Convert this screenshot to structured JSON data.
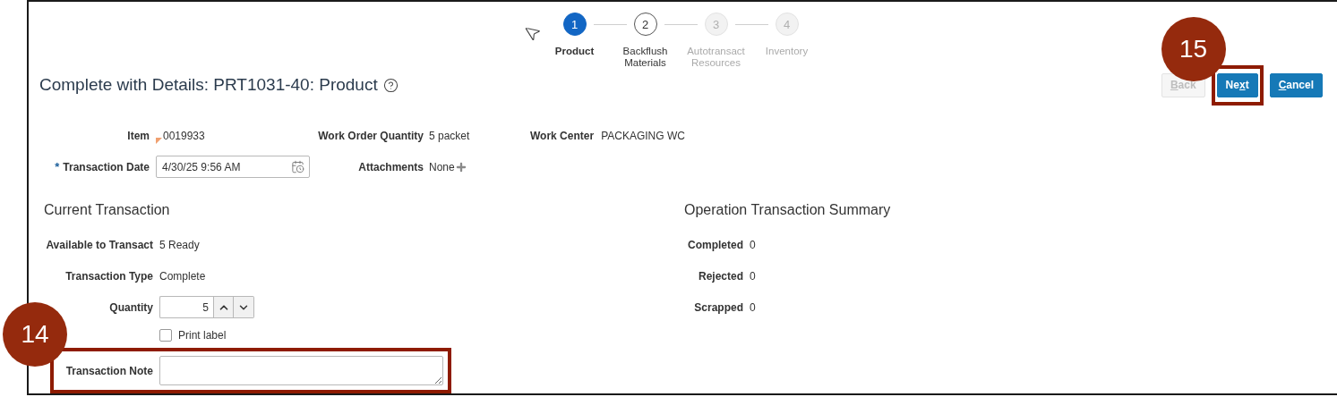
{
  "stepper": {
    "steps": [
      {
        "number": "1",
        "label": "Product",
        "selected": true,
        "disabled": false
      },
      {
        "number": "2",
        "label": "Backflush Materials",
        "selected": false,
        "disabled": false
      },
      {
        "number": "3",
        "label": "Autotransact Resources",
        "selected": false,
        "disabled": true
      },
      {
        "number": "4",
        "label": "Inventory",
        "selected": false,
        "disabled": true
      }
    ]
  },
  "title": "Complete with Details: PRT1031-40: Product",
  "buttons": [
    {
      "key": "B",
      "after": "ack",
      "disabled": true,
      "highlighted": false
    },
    {
      "before": "Ne",
      "key": "x",
      "after": "t",
      "disabled": false,
      "highlighted": true,
      "callout": "15"
    },
    {
      "key": "C",
      "after": "ancel",
      "disabled": false,
      "highlighted": false
    }
  ],
  "header_fields": [
    [
      {
        "kind": "text",
        "label": "Item",
        "value": "0019933",
        "marked": true
      },
      {
        "kind": "text",
        "label": "Work Order Quantity",
        "value": "5 packet"
      },
      {
        "kind": "text",
        "label": "Work Center",
        "value": "PACKAGING WC"
      }
    ],
    [
      {
        "kind": "date",
        "label": "Transaction Date",
        "required_mark": "*",
        "value": "4/30/25 9:56 AM"
      },
      {
        "kind": "attachment",
        "label": "Attachments",
        "value": "None"
      }
    ]
  ],
  "current_transaction": {
    "title": "Current Transaction",
    "rows": [
      {
        "kind": "text",
        "label": "Available to Transact",
        "value": "5 Ready"
      },
      {
        "kind": "text",
        "label": "Transaction Type",
        "value": "Complete"
      },
      {
        "kind": "quantity",
        "label": "Quantity",
        "value": "5"
      },
      {
        "kind": "checkbox",
        "label": "Print label",
        "checked": false
      },
      {
        "kind": "note",
        "label": "Transaction Note",
        "highlighted": true,
        "callout": "14"
      }
    ]
  },
  "operation_summary": {
    "title": "Operation Transaction Summary",
    "rows": [
      {
        "label": "Completed",
        "value": "0"
      },
      {
        "label": "Rejected",
        "value": "0"
      },
      {
        "label": "Scrapped",
        "value": "0"
      }
    ]
  }
}
